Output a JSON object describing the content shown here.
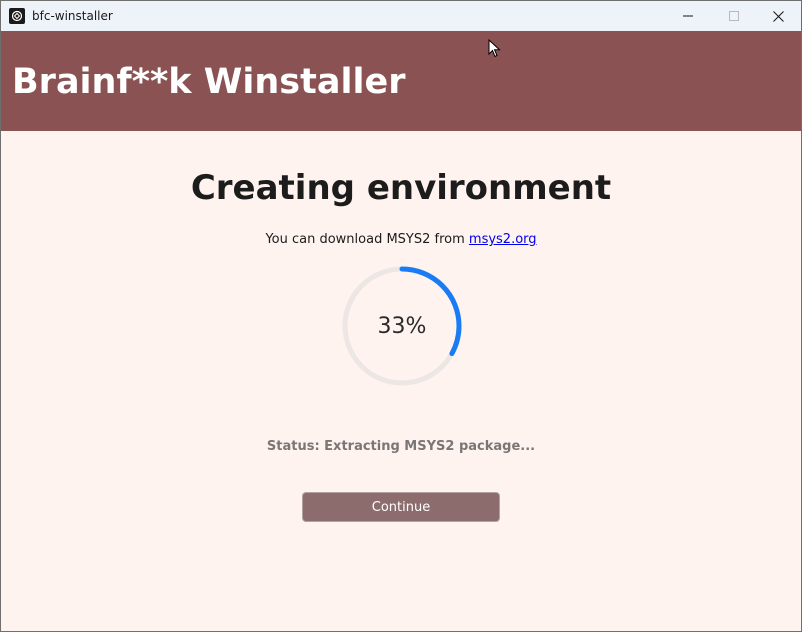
{
  "window": {
    "title": "bfc-winstaller",
    "controls": {
      "minimize_icon": "minimize-icon",
      "maximize_icon": "maximize-icon",
      "close_icon": "close-icon"
    }
  },
  "header": {
    "title": "Brainf**k Winstaller",
    "background_color": "#8a5252"
  },
  "main": {
    "heading": "Creating environment",
    "download_prefix": "You can download MSYS2 from ",
    "download_link": "msys2.org",
    "progress": {
      "percent": 33,
      "label": "33%",
      "color": "#1a7cf5",
      "track_color": "#ece6e4"
    },
    "status": "Status: Extracting MSYS2 package...",
    "continue_label": "Continue"
  },
  "colors": {
    "background": "#fef3ef",
    "titlebar": "#eef2f9",
    "button": "#8c6c6c",
    "status_text": "#7b7676",
    "link": "#0000ee"
  }
}
